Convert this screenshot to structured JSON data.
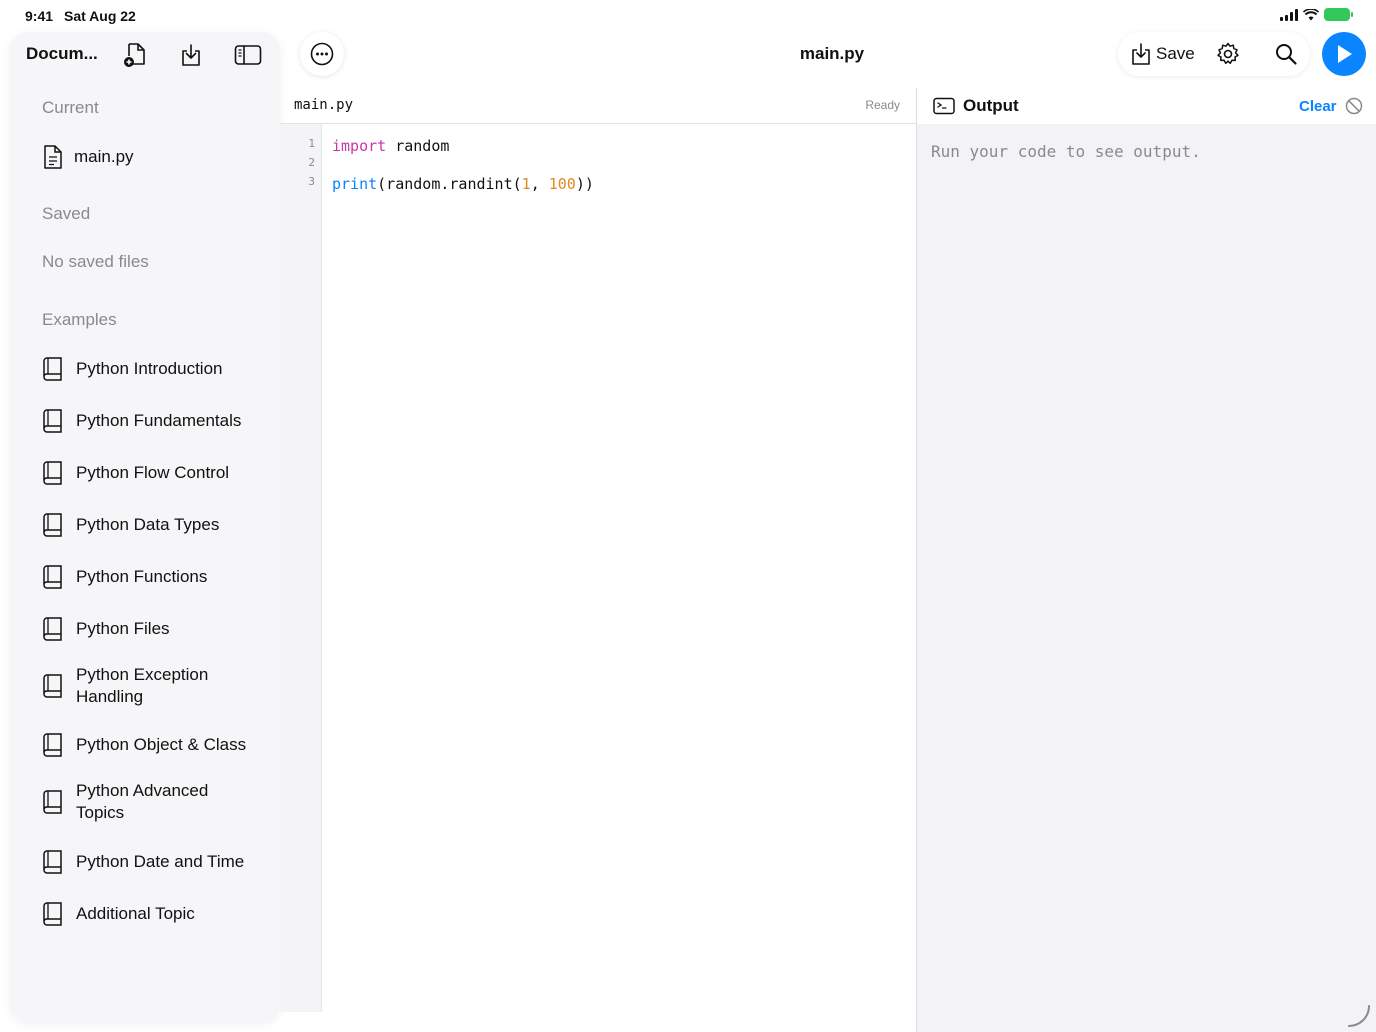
{
  "status_bar": {
    "time": "9:41",
    "date": "Sat Aug 22"
  },
  "sidebar": {
    "title": "Docum...",
    "sections": {
      "current": "Current",
      "saved": "Saved",
      "examples": "Examples"
    },
    "current_file": "main.py",
    "saved_empty": "No saved files",
    "examples": [
      "Python Introduction",
      "Python Fundamentals",
      "Python Flow Control",
      "Python Data Types",
      "Python Functions",
      "Python Files",
      "Python Exception Handling",
      "Python Object & Class",
      "Python Advanced Topics",
      "Python Date and Time",
      "Additional Topic"
    ]
  },
  "toolbar": {
    "doc_title": "main.py",
    "save_label": "Save"
  },
  "editor": {
    "filename": "main.py",
    "status": "Ready",
    "line_numbers": [
      "1",
      "2",
      "3"
    ],
    "code": {
      "l1_kw": "import",
      "l1_rest": " random",
      "l3_fn": "print",
      "l3_a": "(random.randint(",
      "l3_n1": "1",
      "l3_b": ", ",
      "l3_n2": "100",
      "l3_c": "))"
    }
  },
  "output": {
    "title": "Output",
    "clear_label": "Clear",
    "placeholder": "Run your code to see output."
  },
  "colors": {
    "accent": "#0a84ff",
    "keyword": "#c837ab",
    "number": "#e08a1e"
  }
}
